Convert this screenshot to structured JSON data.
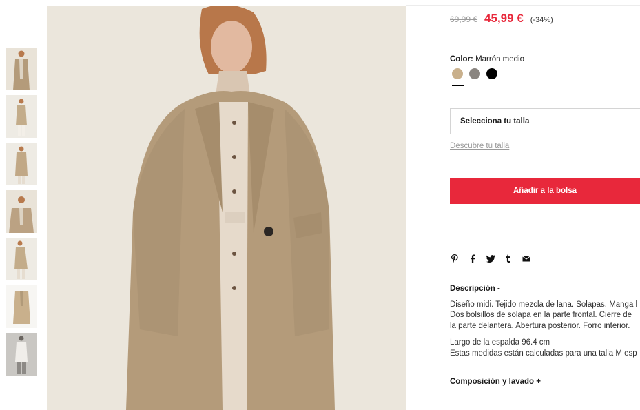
{
  "product": {
    "price_old": "69,99 €",
    "price_new": "45,99 €",
    "discount": "(-34%)"
  },
  "color": {
    "label": "Color:",
    "value": "Marrón medio",
    "swatches": [
      {
        "name": "camel",
        "hex": "#c9b08c"
      },
      {
        "name": "gray",
        "hex": "#8a8580"
      },
      {
        "name": "black",
        "hex": "#000000"
      }
    ]
  },
  "size": {
    "select_label": "Selecciona tu talla",
    "guide_link": "Descubre tu talla"
  },
  "cart": {
    "add_label": "Añadir a la bolsa"
  },
  "share": {
    "icons": [
      "pinterest-icon",
      "facebook-icon",
      "twitter-icon",
      "tumblr-icon",
      "email-icon"
    ]
  },
  "description": {
    "title": "Descripción -",
    "lines": [
      "Diseño midi. Tejido mezcla de lana. Solapas. Manga l",
      "Dos bolsillos de solapa en la parte frontal. Cierre de",
      "la parte delantera. Abertura posterior. Forro interior.",
      "Largo de la espalda 96.4 cm",
      "Estas medidas están calculadas para una talla M esp"
    ]
  },
  "composition": {
    "title": "Composición y lavado +"
  },
  "colors": {
    "sale_red": "#e8283b",
    "coat_camel": "#b49b7a",
    "bg_beige": "#ebe6dc"
  }
}
